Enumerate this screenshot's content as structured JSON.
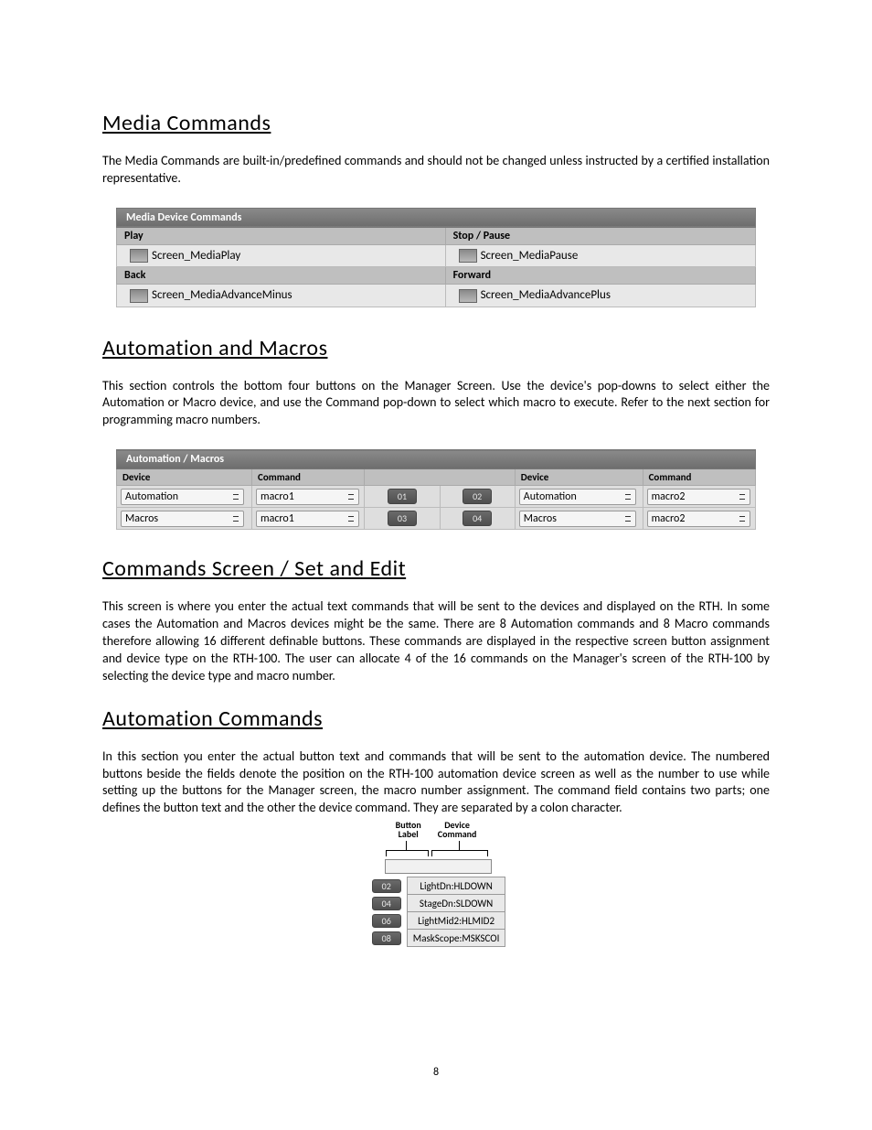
{
  "page_number": "8",
  "section1": {
    "heading": "Media Commands",
    "paragraph": "The Media Commands are built-in/predefined commands and should not be changed unless instructed by a certified installation representative.",
    "panel_title": "Media Device Commands",
    "rows": [
      {
        "left_label": "Play",
        "left_value": "Screen_MediaPlay",
        "right_label": "Stop / Pause",
        "right_value": "Screen_MediaPause"
      },
      {
        "left_label": "Back",
        "left_value": "Screen_MediaAdvanceMinus",
        "right_label": "Forward",
        "right_value": "Screen_MediaAdvancePlus"
      }
    ]
  },
  "section2": {
    "heading": "Automation and Macros",
    "paragraph": "This section controls the bottom four buttons on the Manager Screen.  Use the device's pop-downs to select either the Automation or Macro device, and use the Command pop-down to select which macro to execute.   Refer to the next section for programming macro numbers.",
    "panel_title": "Automation / Macros",
    "col_headers": {
      "device": "Device",
      "command": "Command"
    },
    "rows": [
      {
        "dev_l": "Automation",
        "cmd_l": "macro1",
        "num_l": "01",
        "num_r": "02",
        "dev_r": "Automation",
        "cmd_r": "macro2"
      },
      {
        "dev_l": "Macros",
        "cmd_l": "macro1",
        "num_l": "03",
        "num_r": "04",
        "dev_r": "Macros",
        "cmd_r": "macro2"
      }
    ]
  },
  "section3": {
    "heading": "Commands Screen / Set and Edit",
    "paragraph": "This screen is where you enter the actual text commands that will be sent to the devices and displayed on the RTH. In some cases the Automation and Macros devices might be the same.  There are 8 Automation commands and 8 Macro commands therefore allowing 16 different definable buttons.  These commands are displayed in the respective screen button assignment and device type on the RTH-100.  The user can allocate 4 of the 16 commands on the Manager's screen of the RTH-100 by selecting the device type and macro number."
  },
  "section4": {
    "heading": "Automation Commands",
    "paragraph": "In this section you enter the actual button text and commands that will be sent to the automation device.  The numbered buttons beside the fields denote the position on the RTH-100 automation device screen as well as the number to use while setting up the buttons for the Manager screen, the macro number assignment. The command field contains two parts; one defines the button text and the other the device command. They are separated by a colon character.",
    "diagram_labels": {
      "left": "Button\nLabel",
      "right": "Device\nCommand"
    },
    "cmd_rows": [
      {
        "num": "02",
        "text": "LightDn:HLDOWN"
      },
      {
        "num": "04",
        "text": "StageDn:SLDOWN"
      },
      {
        "num": "06",
        "text": "LightMid2:HLMID2"
      },
      {
        "num": "08",
        "text": "MaskScope:MSKSCOI"
      }
    ]
  }
}
